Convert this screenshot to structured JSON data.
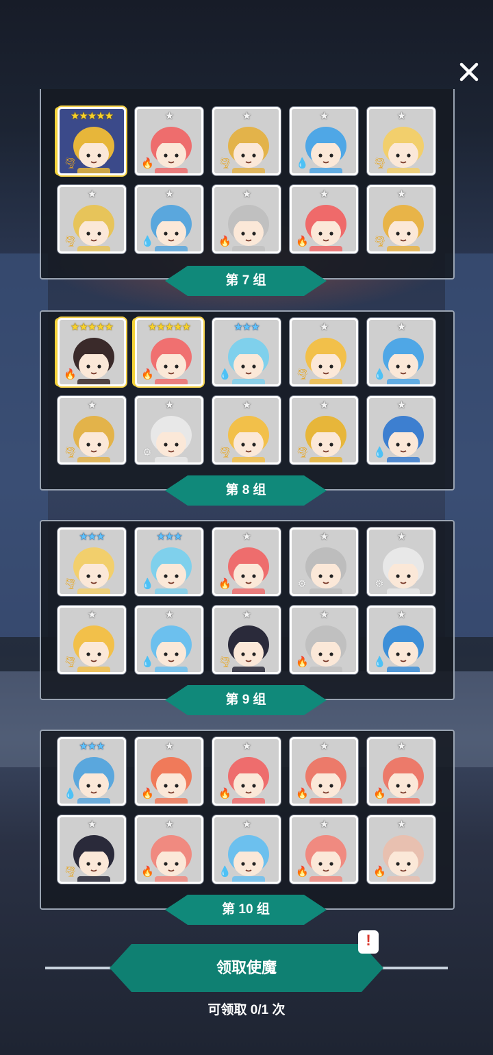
{
  "close_icon": "close-icon",
  "groups": [
    {
      "label": "第 7 组",
      "cards": [
        {
          "stars": "★★★★★",
          "star_color": "gold",
          "element": "wind",
          "bg": "#3b4a8a",
          "hair": "#e7b63a",
          "rare": true
        },
        {
          "stars": "★",
          "star_color": "white",
          "element": "fire",
          "bg": "#d9d9d9",
          "hair": "#ee6d6d",
          "rare": false
        },
        {
          "stars": "★",
          "star_color": "white",
          "element": "wind",
          "bg": "#d9d9d9",
          "hair": "#e3b34a",
          "rare": false
        },
        {
          "stars": "★",
          "star_color": "white",
          "element": "water",
          "bg": "#d9d9d9",
          "hair": "#4fa7e6",
          "rare": false
        },
        {
          "stars": "★",
          "star_color": "white",
          "element": "wind",
          "bg": "#d9d9d9",
          "hair": "#f2cf6c",
          "rare": false
        },
        {
          "stars": "★",
          "star_color": "white",
          "element": "wind",
          "bg": "#d9d9d9",
          "hair": "#e7c45a",
          "rare": false
        },
        {
          "stars": "★",
          "star_color": "white",
          "element": "water",
          "bg": "#d9d9d9",
          "hair": "#5aa7dd",
          "rare": false
        },
        {
          "stars": "★",
          "star_color": "white",
          "element": "fire",
          "bg": "#d9d9d9",
          "hair": "#c0c0c0",
          "rare": false
        },
        {
          "stars": "★",
          "star_color": "white",
          "element": "fire",
          "bg": "#d9d9d9",
          "hair": "#ef6a6a",
          "rare": false
        },
        {
          "stars": "★",
          "star_color": "white",
          "element": "wind",
          "bg": "#d9d9d9",
          "hair": "#e8b448",
          "rare": false
        }
      ]
    },
    {
      "label": "第 8 组",
      "cards": [
        {
          "stars": "★★★★★",
          "star_color": "gold",
          "element": "fire",
          "bg": "#d9d9d9",
          "hair": "#3a2a2a",
          "rare": true
        },
        {
          "stars": "★★★★★",
          "star_color": "gold",
          "element": "fire",
          "bg": "#d9d9d9",
          "hair": "#f07070",
          "rare": true
        },
        {
          "stars": "★★★",
          "star_color": "blue",
          "element": "water",
          "bg": "#d9d9d9",
          "hair": "#7fd0ec",
          "rare": false
        },
        {
          "stars": "★",
          "star_color": "white",
          "element": "wind",
          "bg": "#d9d9d9",
          "hair": "#f2c04a",
          "rare": false
        },
        {
          "stars": "★",
          "star_color": "white",
          "element": "water",
          "bg": "#d9d9d9",
          "hair": "#4fa7e6",
          "rare": false
        },
        {
          "stars": "★",
          "star_color": "white",
          "element": "wind",
          "bg": "#d9d9d9",
          "hair": "#e3b34a",
          "rare": false
        },
        {
          "stars": "★",
          "star_color": "white",
          "element": "light",
          "bg": "#d9d9d9",
          "hair": "#e8e8e8",
          "rare": false
        },
        {
          "stars": "★",
          "star_color": "white",
          "element": "wind",
          "bg": "#d9d9d9",
          "hair": "#f2c04a",
          "rare": false
        },
        {
          "stars": "★",
          "star_color": "white",
          "element": "wind",
          "bg": "#d9d9d9",
          "hair": "#e7b63a",
          "rare": false
        },
        {
          "stars": "★",
          "star_color": "white",
          "element": "water",
          "bg": "#d9d9d9",
          "hair": "#3d7fd0",
          "rare": false
        }
      ]
    },
    {
      "label": "第 9 组",
      "cards": [
        {
          "stars": "★★★",
          "star_color": "blue",
          "element": "wind",
          "bg": "#d9d9d9",
          "hair": "#f2cf6c",
          "rare": false
        },
        {
          "stars": "★★★",
          "star_color": "blue",
          "element": "water",
          "bg": "#d9d9d9",
          "hair": "#7fd0ec",
          "rare": false
        },
        {
          "stars": "★",
          "star_color": "white",
          "element": "fire",
          "bg": "#d9d9d9",
          "hair": "#ee6d6d",
          "rare": false
        },
        {
          "stars": "★",
          "star_color": "white",
          "element": "light",
          "bg": "#d9d9d9",
          "hair": "#bdbdbd",
          "rare": false
        },
        {
          "stars": "★",
          "star_color": "white",
          "element": "light",
          "bg": "#d9d9d9",
          "hair": "#e8e8e8",
          "rare": false
        },
        {
          "stars": "★",
          "star_color": "white",
          "element": "wind",
          "bg": "#d9d9d9",
          "hair": "#f2c04a",
          "rare": false
        },
        {
          "stars": "★",
          "star_color": "white",
          "element": "water",
          "bg": "#d9d9d9",
          "hair": "#6cc0ee",
          "rare": false
        },
        {
          "stars": "★",
          "star_color": "white",
          "element": "wind",
          "bg": "#d9d9d9",
          "hair": "#2a2a3a",
          "rare": false
        },
        {
          "stars": "★",
          "star_color": "white",
          "element": "fire",
          "bg": "#d9d9d9",
          "hair": "#c0c0c0",
          "rare": false
        },
        {
          "stars": "★",
          "star_color": "white",
          "element": "water",
          "bg": "#d9d9d9",
          "hair": "#3d8fd8",
          "rare": false
        }
      ]
    },
    {
      "label": "第 10 组",
      "cards": [
        {
          "stars": "★★★",
          "star_color": "blue",
          "element": "water",
          "bg": "#d9d9d9",
          "hair": "#5aa7dd",
          "rare": false
        },
        {
          "stars": "★",
          "star_color": "white",
          "element": "fire",
          "bg": "#d9d9d9",
          "hair": "#f07a5a",
          "rare": false
        },
        {
          "stars": "★",
          "star_color": "white",
          "element": "fire",
          "bg": "#d9d9d9",
          "hair": "#ee6d6d",
          "rare": false
        },
        {
          "stars": "★",
          "star_color": "white",
          "element": "fire",
          "bg": "#d9d9d9",
          "hair": "#ec7a6a",
          "rare": false
        },
        {
          "stars": "★",
          "star_color": "white",
          "element": "fire",
          "bg": "#d9d9d9",
          "hair": "#ec7a6a",
          "rare": false
        },
        {
          "stars": "★",
          "star_color": "white",
          "element": "wind",
          "bg": "#d9d9d9",
          "hair": "#2a2a3a",
          "rare": false
        },
        {
          "stars": "★",
          "star_color": "white",
          "element": "fire",
          "bg": "#d9d9d9",
          "hair": "#f08a80",
          "rare": false
        },
        {
          "stars": "★",
          "star_color": "white",
          "element": "water",
          "bg": "#d9d9d9",
          "hair": "#6cc0ee",
          "rare": false
        },
        {
          "stars": "★",
          "star_color": "white",
          "element": "fire",
          "bg": "#d9d9d9",
          "hair": "#f08a80",
          "rare": false
        },
        {
          "stars": "★",
          "star_color": "white",
          "element": "fire",
          "bg": "#d9d9d9",
          "hair": "#e8c0b0",
          "rare": false
        }
      ]
    }
  ],
  "element_glyphs": {
    "fire": "🔥",
    "water": "💧",
    "wind": "🌪",
    "light": "⚙"
  },
  "claim": {
    "button_label": "领取使魔",
    "alert": "!",
    "count_text": "可领取 0/1 次"
  },
  "colors": {
    "accent": "#10897a",
    "panel_border": "#9aa4b2"
  }
}
